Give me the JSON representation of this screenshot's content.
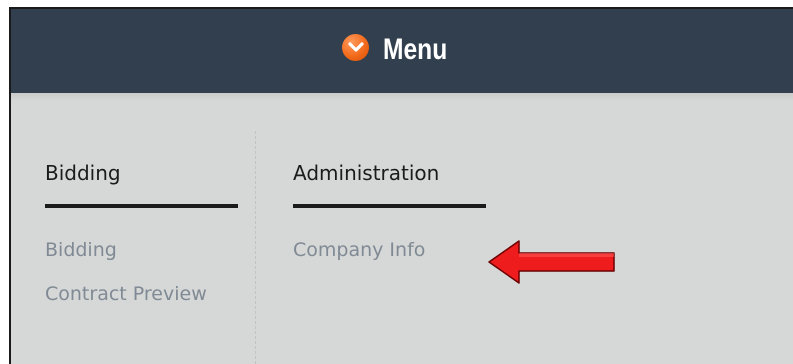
{
  "header": {
    "title": "Menu",
    "icon": "chevron-down-circle-icon",
    "background": "#323f4e",
    "icon_color": "#f26a1b"
  },
  "columns": [
    {
      "heading": "Bidding",
      "links": [
        "Bidding",
        "Contract Preview"
      ]
    },
    {
      "heading": "Administration",
      "links": [
        "Company Info"
      ]
    }
  ],
  "annotation": {
    "icon": "red-arrow-icon",
    "color": "#ee1c1c",
    "points_to": "Company Info"
  }
}
